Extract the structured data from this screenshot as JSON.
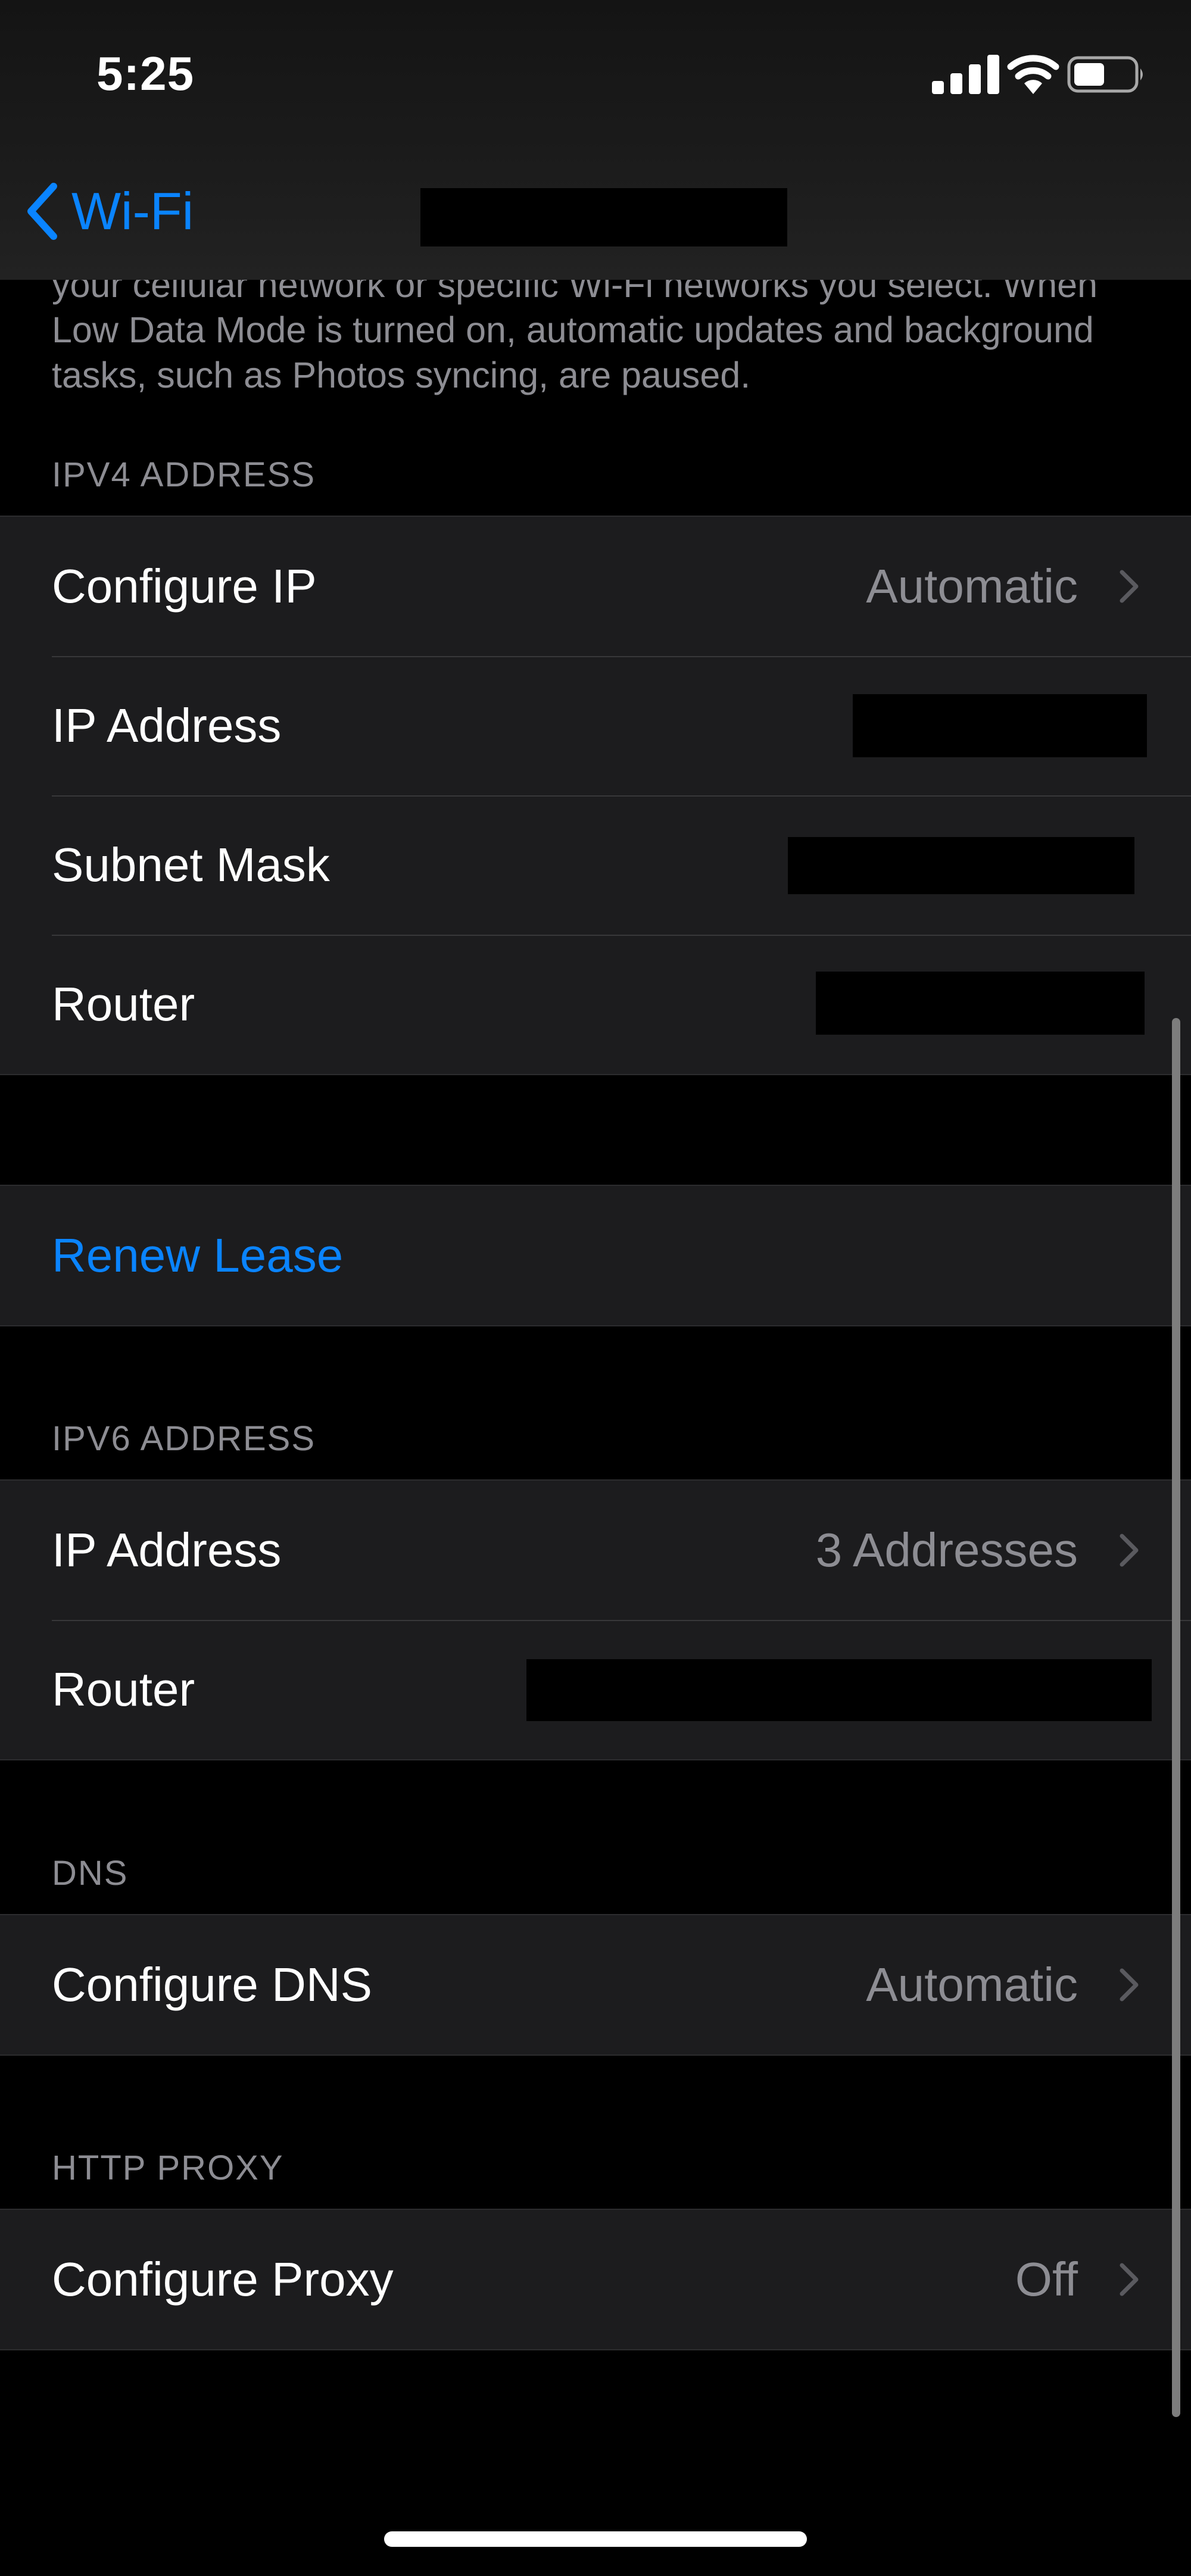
{
  "status_bar": {
    "time": "5:25"
  },
  "nav": {
    "back_label": "Wi-Fi"
  },
  "low_data_footer": "your cellular network or specific Wi-Fi networks you select. When Low Data Mode is turned on, automatic updates and background tasks, such as Photos syncing, are paused.",
  "ipv4": {
    "header": "IPV4 ADDRESS",
    "rows": [
      {
        "label": "Configure IP",
        "value": "Automatic"
      },
      {
        "label": "IP Address",
        "value": ""
      },
      {
        "label": "Subnet Mask",
        "value": ""
      },
      {
        "label": "Router",
        "value": ""
      }
    ]
  },
  "renew_lease": "Renew Lease",
  "ipv6": {
    "header": "IPV6 ADDRESS",
    "rows": [
      {
        "label": "IP Address",
        "value": "3 Addresses"
      },
      {
        "label": "Router",
        "value": ""
      }
    ]
  },
  "dns": {
    "header": "DNS",
    "rows": [
      {
        "label": "Configure DNS",
        "value": "Automatic"
      }
    ]
  },
  "http_proxy": {
    "header": "HTTP PROXY",
    "rows": [
      {
        "label": "Configure Proxy",
        "value": "Off"
      }
    ]
  },
  "colors": {
    "accent": "#0a84ff",
    "cell_bg": "#1c1c1e",
    "secondary_text": "#8d8d93"
  },
  "icons": [
    "signal-icon",
    "wifi-icon",
    "battery-icon",
    "back-chevron-icon",
    "chevron-right-icon"
  ]
}
